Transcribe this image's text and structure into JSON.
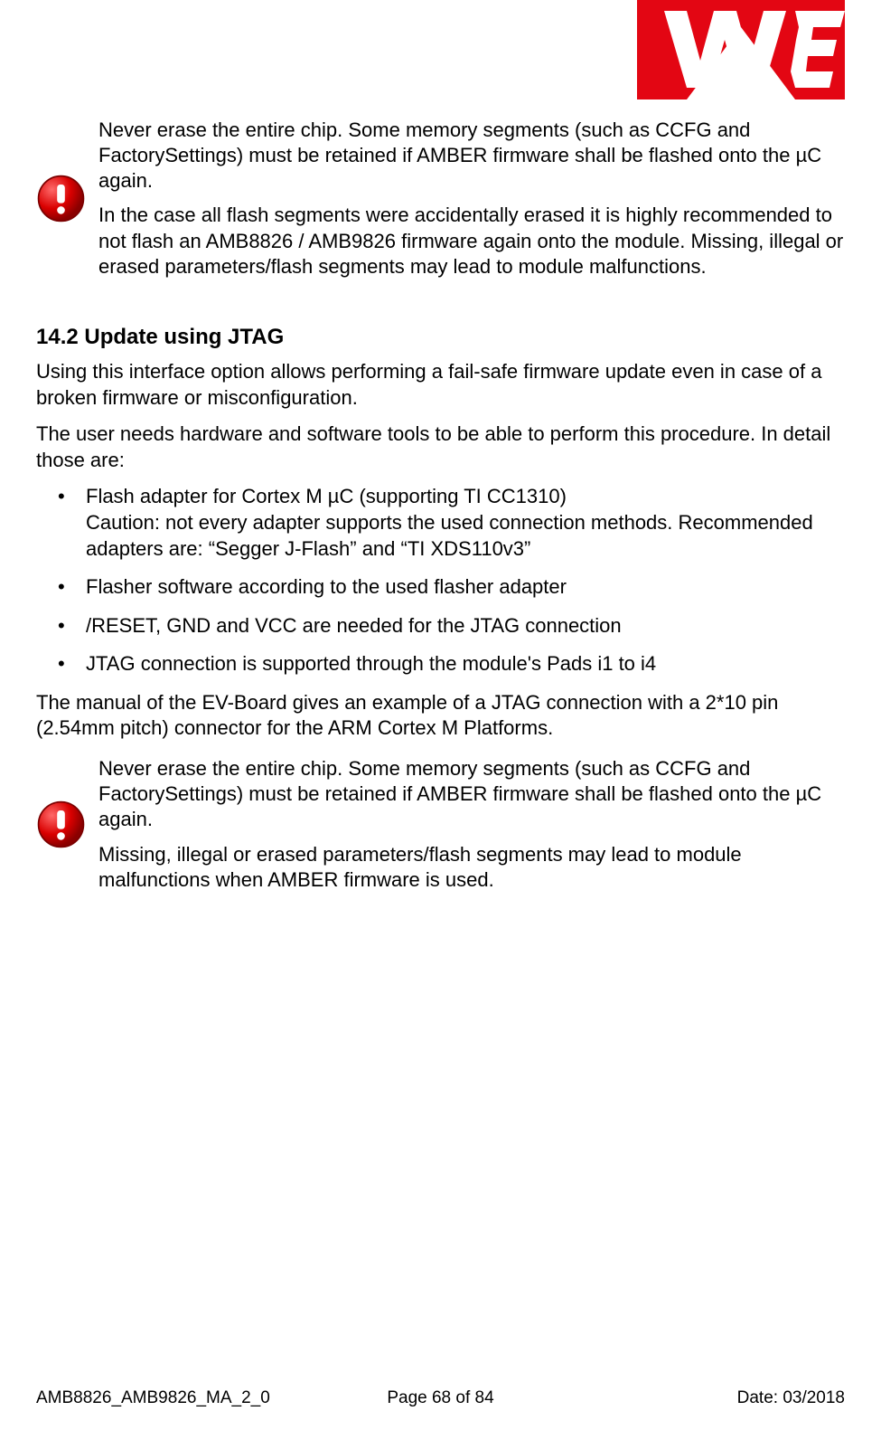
{
  "warning1": {
    "p1": "Never erase the entire chip. Some memory segments (such as CCFG and FactorySettings) must be retained if AMBER firmware shall be flashed onto the µC again.",
    "p2": "In the case all flash segments were accidentally erased it is highly recommended to not flash an AMB8826 / AMB9826 firmware again onto the module. Missing, illegal or erased parameters/flash segments may lead to module malfunctions."
  },
  "section": {
    "heading": "14.2 Update using JTAG",
    "intro1": "Using this interface option allows performing a fail-safe firmware update even in case of a broken firmware or misconfiguration.",
    "intro2": "The user needs hardware and software tools to be able to perform this procedure. In detail those are:",
    "bullets": [
      "Flash adapter for Cortex M µC (supporting TI CC1310)\nCaution: not every adapter supports the used connection methods. Recommended adapters are: “Segger J-Flash” and “TI XDS110v3”",
      "Flasher software according to the used flasher adapter",
      "/RESET, GND and VCC are needed for the JTAG connection",
      "JTAG connection is supported through the module's Pads i1 to i4"
    ],
    "after": "The manual of the EV-Board gives an example of a JTAG connection with a 2*10 pin (2.54mm pitch) connector for the ARM Cortex M Platforms."
  },
  "warning2": {
    "p1": "Never erase the entire chip. Some memory segments (such as CCFG and FactorySettings) must be retained if AMBER firmware shall be flashed onto the µC again.",
    "p2": "Missing, illegal or erased parameters/flash segments may lead to module malfunctions when AMBER firmware is used."
  },
  "footer": {
    "left": "AMB8826_AMB9826_MA_2_0",
    "center": "Page 68 of 84",
    "right": "Date: 03/2018"
  }
}
